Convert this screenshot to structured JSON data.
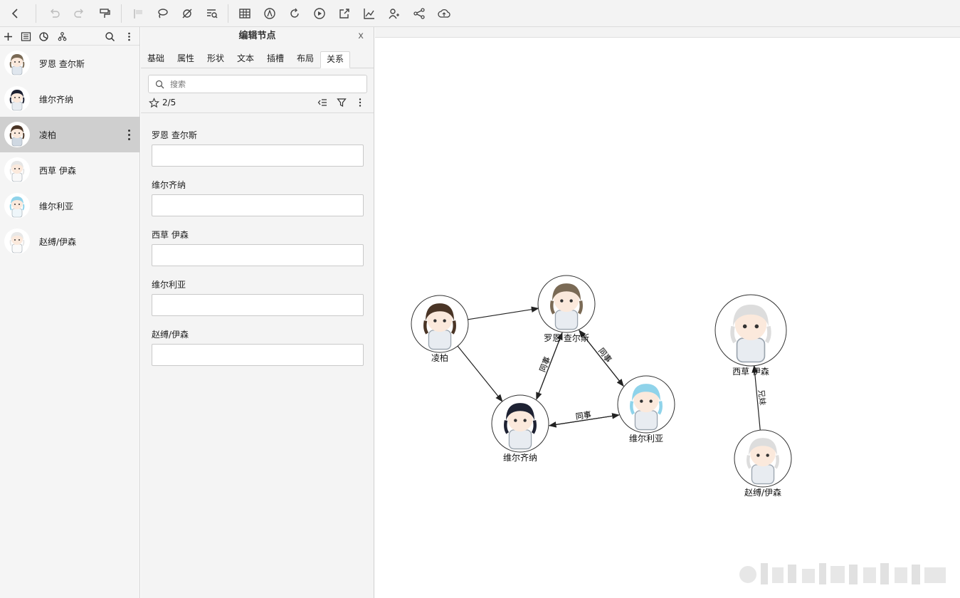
{
  "toolbar": {
    "buttons": [
      "back-icon",
      "undo-icon",
      "redo-icon",
      "format-painter-icon",
      "flag-icon",
      "lasso-icon",
      "no-edge-icon",
      "search-list-icon",
      "table-icon",
      "compass-icon",
      "refresh-icon",
      "play-icon",
      "export-icon",
      "chart-icon",
      "user-group-icon",
      "share-icon",
      "cloud-upload-icon"
    ]
  },
  "left_panel": {
    "nodes": [
      {
        "label": "罗恩 查尔斯",
        "avatar_hair": "#7a6a55",
        "avatar_accent": "#dfe6ee"
      },
      {
        "label": "维尔齐纳",
        "avatar_hair": "#1e2233",
        "avatar_accent": "#e8ecf1"
      },
      {
        "label": "凌柏",
        "avatar_hair": "#4a3526",
        "avatar_accent": "#cfd8e2",
        "selected": true
      },
      {
        "label": "西草 伊森",
        "avatar_hair": "#e6e6e6",
        "avatar_accent": "#f8f8f8"
      },
      {
        "label": "维尔利亚",
        "avatar_hair": "#8fd3ea",
        "avatar_accent": "#eef6fa"
      },
      {
        "label": "赵缚/伊森",
        "avatar_hair": "#e8e8e8",
        "avatar_accent": "#fafafa"
      }
    ]
  },
  "edit_panel": {
    "title": "编辑节点",
    "close_label": "x",
    "tabs": [
      "基础",
      "属性",
      "形状",
      "文本",
      "插槽",
      "布局",
      "关系"
    ],
    "active_tab": "关系",
    "search": {
      "placeholder": "搜索",
      "value": ""
    },
    "count": "2/5",
    "fields": [
      {
        "label": "罗恩 查尔斯",
        "value": "",
        "has_menu": true
      },
      {
        "label": "维尔齐纳",
        "value": "",
        "has_menu": true
      },
      {
        "label": "西草 伊森",
        "value": "",
        "has_menu": false
      },
      {
        "label": "维尔利亚",
        "value": "",
        "has_menu": false
      },
      {
        "label": "赵缚/伊森",
        "value": "",
        "has_menu": false
      }
    ]
  },
  "graph": {
    "nodes": [
      {
        "id": "lingbai",
        "label": "凌柏",
        "hair": "#4a3526"
      },
      {
        "id": "roen",
        "label": "罗恩 查尔斯",
        "hair": "#7a6a55"
      },
      {
        "id": "weierqina",
        "label": "维尔齐纳",
        "hair": "#1e2233"
      },
      {
        "id": "weierliya",
        "label": "维尔利亚",
        "hair": "#8fd3ea"
      },
      {
        "id": "xicao",
        "label": "西草 伊森",
        "hair": "#dddddd"
      },
      {
        "id": "zhaofu",
        "label": "赵缚/伊森",
        "hair": "#dddddd"
      }
    ],
    "edges": [
      {
        "from": "lingbai",
        "to": "roen",
        "label": ""
      },
      {
        "from": "lingbai",
        "to": "weierqina",
        "label": ""
      },
      {
        "from": "roen",
        "to": "weierqina",
        "label": "同事"
      },
      {
        "from": "weierqina",
        "to": "roen",
        "label": "同事"
      },
      {
        "from": "roen",
        "to": "weierliya",
        "label": "同事"
      },
      {
        "from": "weierliya",
        "to": "roen",
        "label": "同事"
      },
      {
        "from": "weierqina",
        "to": "weierliya",
        "label": "同事"
      },
      {
        "from": "weierliya",
        "to": "weierqina",
        "label": "同事"
      },
      {
        "from": "zhaofu",
        "to": "xicao",
        "label": "兄妹"
      }
    ]
  }
}
